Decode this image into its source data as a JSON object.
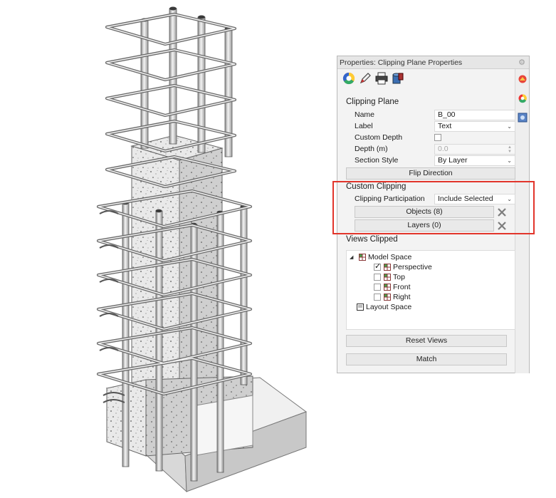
{
  "panel": {
    "title": "Properties: Clipping Plane Properties",
    "tab_icons": [
      "color-wheel-icon",
      "pen-edit-icon",
      "printer-icon",
      "database-icon"
    ],
    "side_tab_icons": [
      "material-icon",
      "color-wheel-icon",
      "clipping-plane-icon"
    ]
  },
  "clipping_plane": {
    "header": "Clipping Plane",
    "name_label": "Name",
    "name_value": "B_00",
    "label_label": "Label",
    "label_value": "Text",
    "custom_depth_label": "Custom Depth",
    "depth_label": "Depth (m)",
    "depth_value": "0.0",
    "section_style_label": "Section Style",
    "section_style_value": "By Layer",
    "flip_direction": "Flip Direction"
  },
  "custom_clipping": {
    "header": "Custom Clipping",
    "participation_label": "Clipping Participation",
    "participation_value": "Include Selected",
    "objects_button": "Objects (8)",
    "layers_button": "Layers (0)"
  },
  "views_clipped": {
    "header": "Views Clipped",
    "model_space": "Model Space",
    "perspective": "Perspective",
    "top": "Top",
    "front": "Front",
    "right": "Right",
    "layout_space": "Layout Space",
    "perspective_checked": true,
    "reset_views": "Reset Views",
    "match": "Match"
  },
  "colors": {
    "highlight_box": "#e2352b",
    "panel_bg": "#f3f3f3"
  }
}
